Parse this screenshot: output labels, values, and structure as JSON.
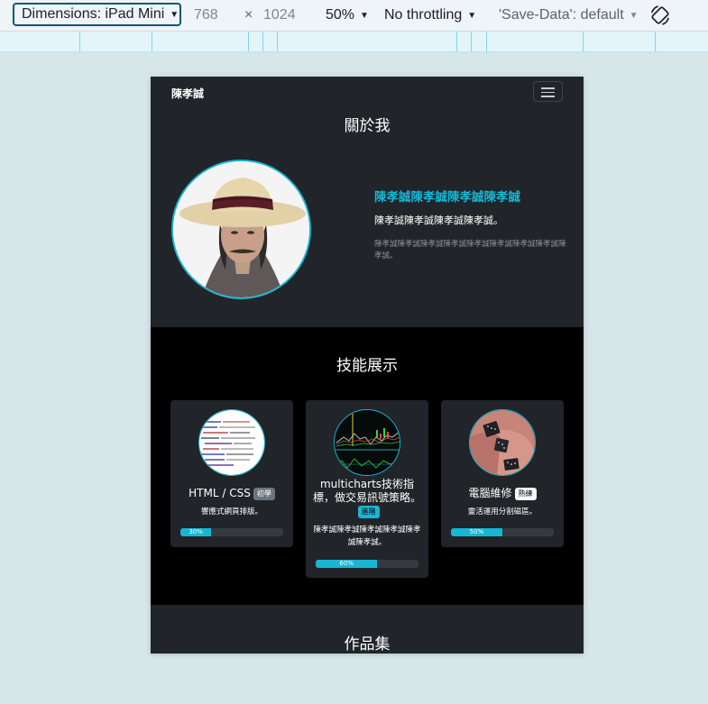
{
  "devtools": {
    "device": "Dimensions: iPad Mini",
    "width": "768",
    "times": "×",
    "height": "1024",
    "zoom": "50%",
    "throttling": "No throttling",
    "save_data": "'Save-Data': default",
    "rotate_icon": "rotate-icon"
  },
  "page": {
    "brand": "陳孝誠",
    "nav_icon": "hamburger-icon",
    "about": {
      "title": "關於我",
      "heading": "陳孝誠陳孝誠陳孝誠陳孝誠",
      "lead": "陳孝誠陳孝誠陳孝誠陳孝誠。",
      "body": "陳孝誠陳孝誠陳孝誠陳孝誠陳孝誠陳孝誠陳孝誠陳孝誠陳孝誠。"
    },
    "skills": {
      "title": "技能展示",
      "cards": [
        {
          "title": "HTML / CSS",
          "badge": "初學",
          "badge_color": "#6c757d",
          "badge_text_color": "#ffffff",
          "desc": "響應式網頁排版。",
          "progress_label": "30%",
          "progress": 0.3
        },
        {
          "title": "multicharts技術指標，做交易訊號策略。",
          "badge": "進階",
          "badge_color": "#17b6d3",
          "badge_text_color": "#000000",
          "desc": "陳孝誠陳孝誠陳孝誠陳孝誠陳孝誠陳孝誠。",
          "progress_label": "60%",
          "progress": 0.6
        },
        {
          "title": "電腦維修",
          "badge": "熟練",
          "badge_color": "#f8f9fa",
          "badge_text_color": "#000000",
          "desc": "靈活運用分割磁區。",
          "progress_label": "50%",
          "progress": 0.5
        }
      ]
    },
    "portfolio": {
      "title": "作品集"
    }
  },
  "colors": {
    "accent": "#17b6d3",
    "dark": "#212529",
    "black": "#000000"
  }
}
